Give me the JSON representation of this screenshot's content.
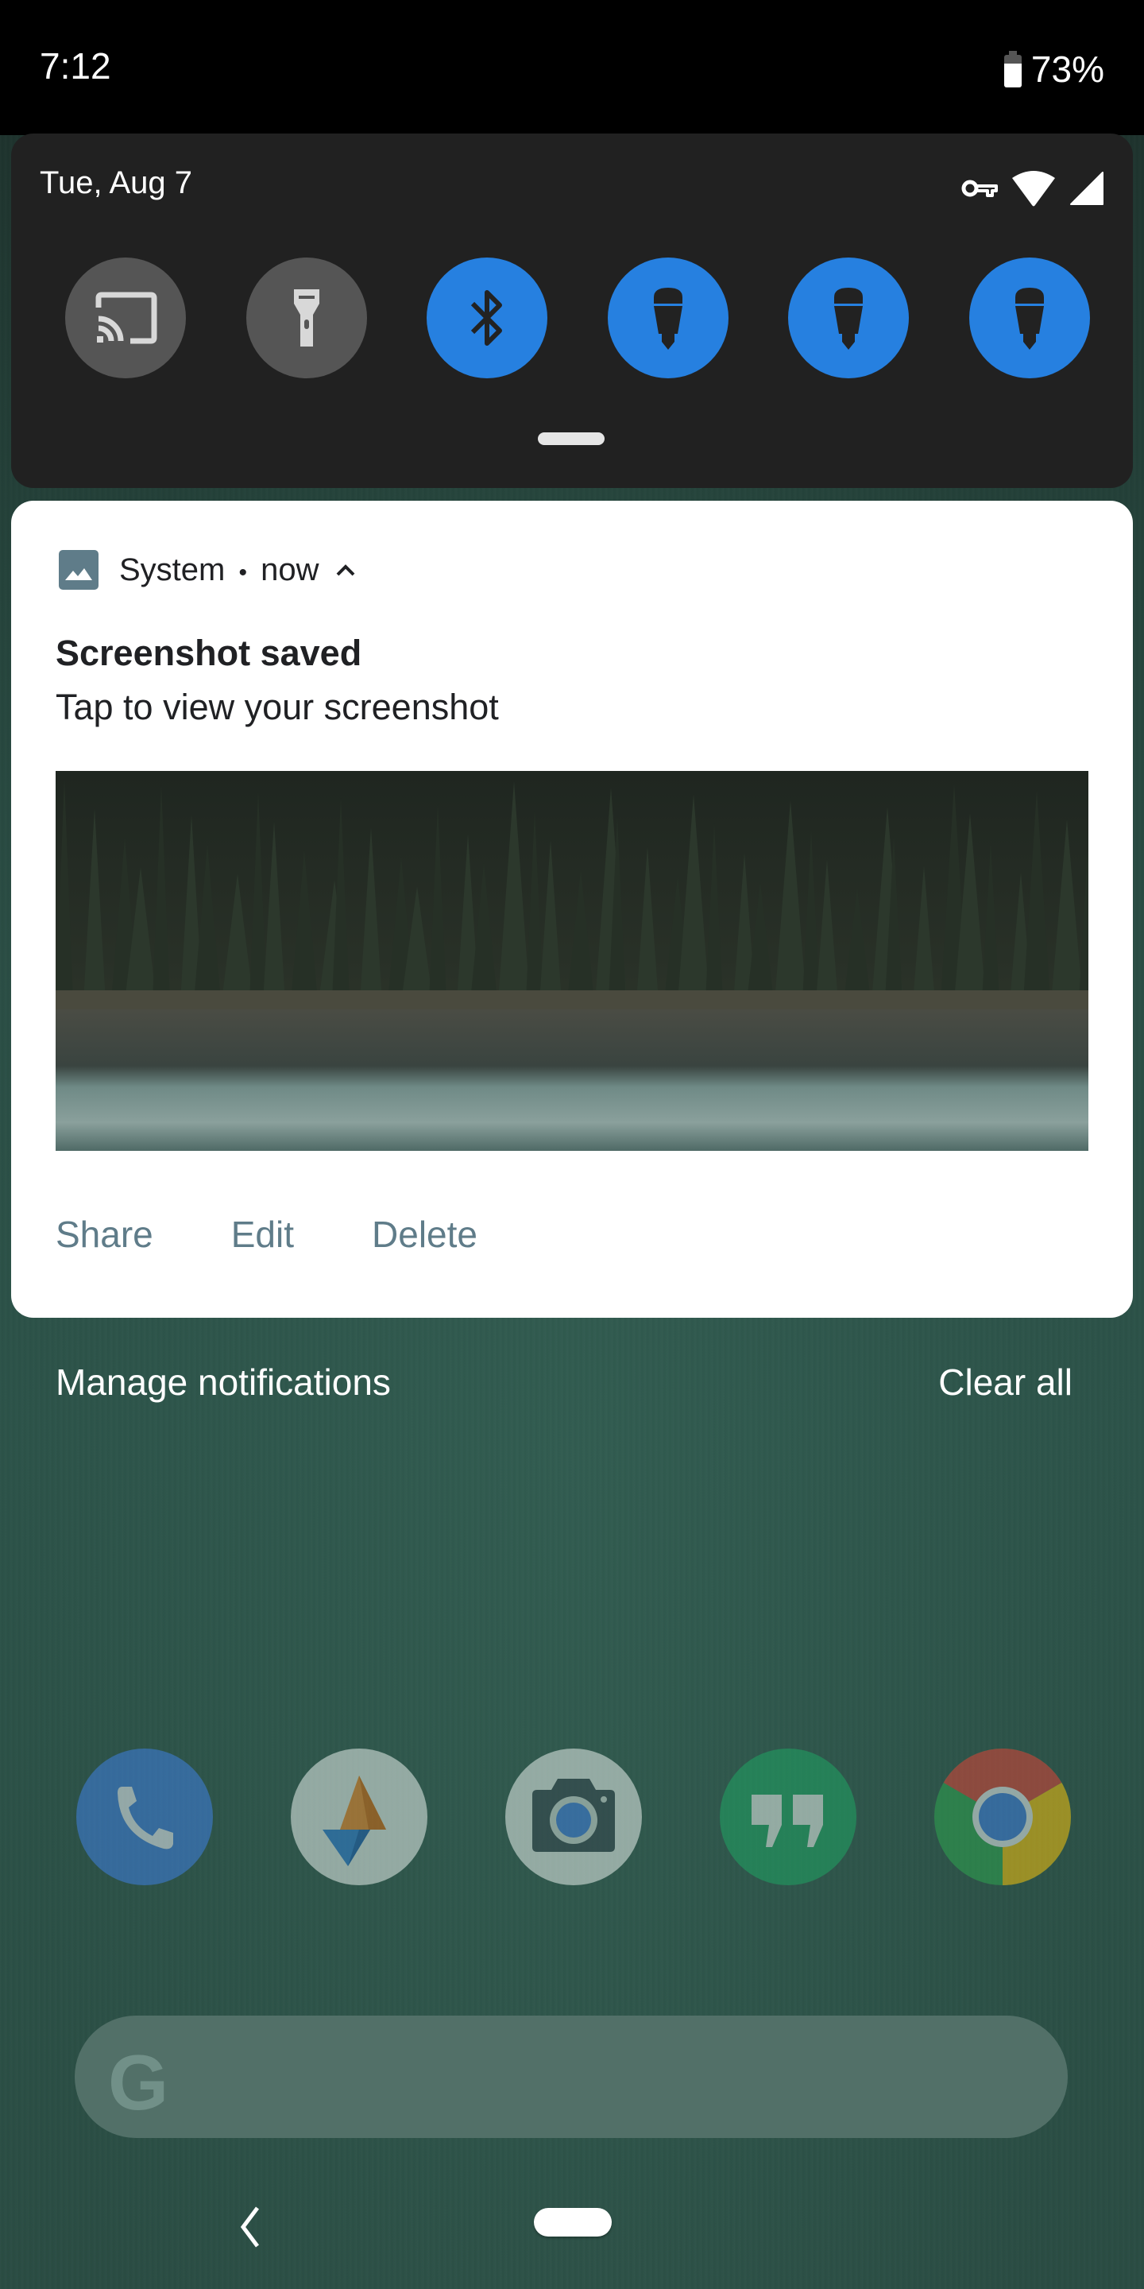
{
  "status_bar": {
    "time": "7:12",
    "battery_percent": "73%",
    "battery_level": 0.73
  },
  "quick_settings": {
    "date": "Tue, Aug 7",
    "status_icons": [
      "vpn-key-icon",
      "wifi-icon",
      "cellular-signal-icon"
    ],
    "tiles": [
      {
        "name": "cast",
        "icon": "cast-icon",
        "state": "off"
      },
      {
        "name": "flashlight",
        "icon": "flashlight-icon",
        "state": "off"
      },
      {
        "name": "bluetooth",
        "icon": "bluetooth-icon",
        "state": "on"
      },
      {
        "name": "light-1",
        "icon": "smart-bulb-icon",
        "state": "on"
      },
      {
        "name": "light-2",
        "icon": "smart-bulb-icon",
        "state": "on"
      },
      {
        "name": "light-3",
        "icon": "smart-bulb-icon",
        "state": "on"
      }
    ],
    "colors": {
      "active": "#2680e0",
      "inactive": "#555555"
    }
  },
  "notification": {
    "app_name": "System",
    "separator": "•",
    "time": "now",
    "title": "Screenshot saved",
    "text": "Tap to view your screenshot",
    "image_description": "forest and lake",
    "actions": [
      "Share",
      "Edit",
      "Delete"
    ],
    "accent_color": "#5f7c89"
  },
  "footer": {
    "manage_label": "Manage notifications",
    "clear_label": "Clear all"
  },
  "dock": {
    "apps": [
      "Phone",
      "Maps",
      "Camera",
      "Hangouts",
      "Chrome"
    ]
  },
  "search": {
    "logo": "G"
  }
}
